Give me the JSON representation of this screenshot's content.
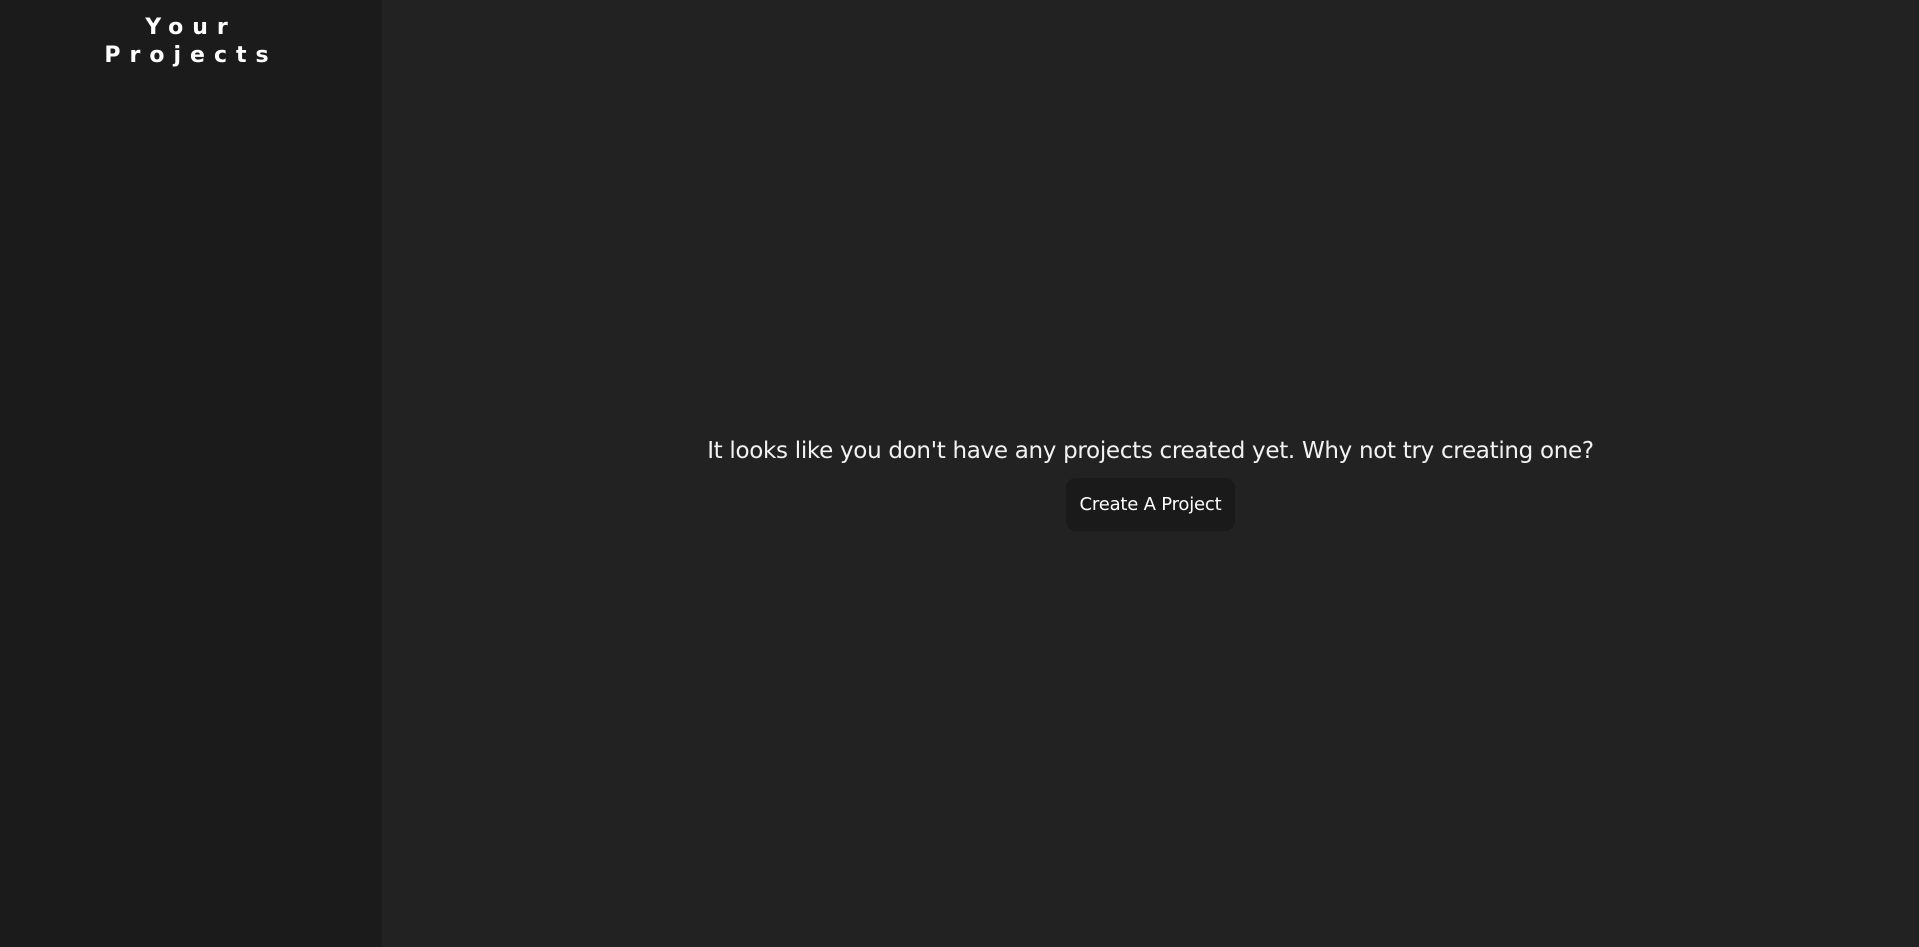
{
  "sidebar": {
    "title_line1": "Your",
    "title_line2": "Projects"
  },
  "main": {
    "empty_message": "It looks like you don't have any projects created yet. Why not try creating one?",
    "create_button_label": "Create A Project"
  },
  "colors": {
    "sidebar_bg": "#1b1b1b",
    "main_bg": "#222222",
    "button_bg": "#1a1a1a",
    "text": "#ffffff"
  }
}
